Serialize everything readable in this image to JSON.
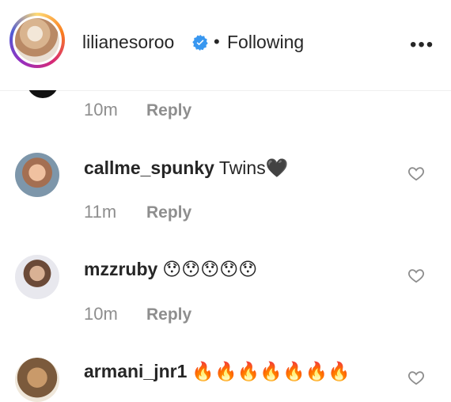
{
  "header": {
    "username": "lilianesoroo",
    "separator": "•",
    "follow_status": "Following",
    "more_label": "•••"
  },
  "comments": [
    {
      "time": "10m",
      "reply": "Reply"
    },
    {
      "user": "callme_spunky",
      "text": "Twins🖤",
      "time": "11m",
      "reply": "Reply"
    },
    {
      "user": "mzzruby",
      "text": "😯😯😯😯😯",
      "time": "10m",
      "reply": "Reply"
    },
    {
      "user": "armani_jnr1",
      "text": "🔥🔥🔥🔥🔥🔥🔥"
    }
  ],
  "colors": {
    "verified": "#3897f0",
    "secondary_text": "#8e8e8e",
    "primary_text": "#262626"
  }
}
